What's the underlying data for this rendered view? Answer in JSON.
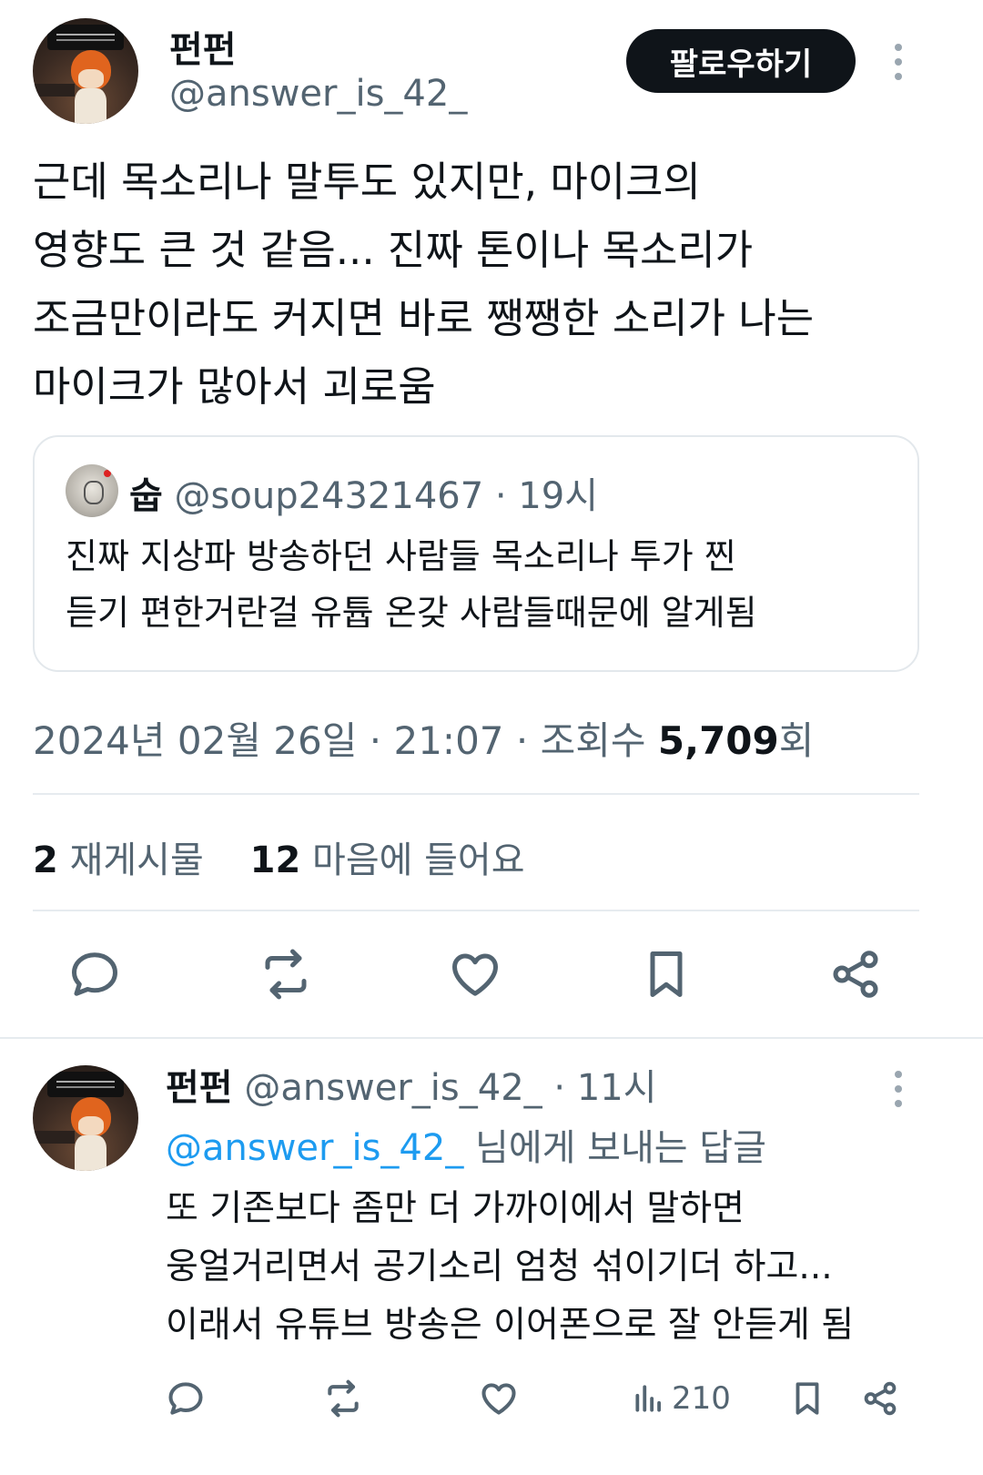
{
  "main_tweet": {
    "author": {
      "display_name": "펀펀",
      "handle": "@answer_is_42_"
    },
    "follow_label": "팔로우하기",
    "text": "근데 목소리나 말투도 있지만, 마이크의\n영향도 큰 것 같음... 진짜 톤이나 목소리가\n조금만이라도 커지면 바로 쨍쨍한 소리가 나는\n마이크가 많아서 괴로움",
    "quote": {
      "display_name": "숩",
      "handle": "@soup24321467",
      "separator": "·",
      "time": "19시",
      "text": "진짜 지상파 방송하던 사람들 목소리나 투가 찐\n듣기 편한거란걸 유튭 온갖 사람들때문에 알게됨"
    },
    "date": "2024년 02월 26일",
    "separator": "·",
    "time": "21:07",
    "views_label": "조회수",
    "views_count": "5,709",
    "views_suffix": "회",
    "reposts_count": "2",
    "reposts_label": "재게시물",
    "likes_count": "12",
    "likes_label": "마음에 들어요"
  },
  "actions": {
    "icons": [
      "reply-icon",
      "repost-icon",
      "like-icon",
      "bookmark-icon",
      "share-icon"
    ]
  },
  "reply": {
    "display_name": "펀펀",
    "handle": "@answer_is_42_",
    "separator": "·",
    "time": "11시",
    "reply_to_mention": "@answer_is_42_",
    "reply_to_suffix": "님에게 보내는 답글",
    "text": "또 기존보다 좀만 더 가까이에서 말하면\n웅얼거리면서 공기소리 엄청 섞이기더 하고...\n이래서 유튜브 방송은 이어폰으로 잘 안듣게 됨",
    "views": "210"
  },
  "colors": {
    "text_primary": "#0f1419",
    "text_secondary": "#536471",
    "accent": "#1d9bf0",
    "divider": "#e6ebef",
    "follow_bg": "#0f1419"
  }
}
